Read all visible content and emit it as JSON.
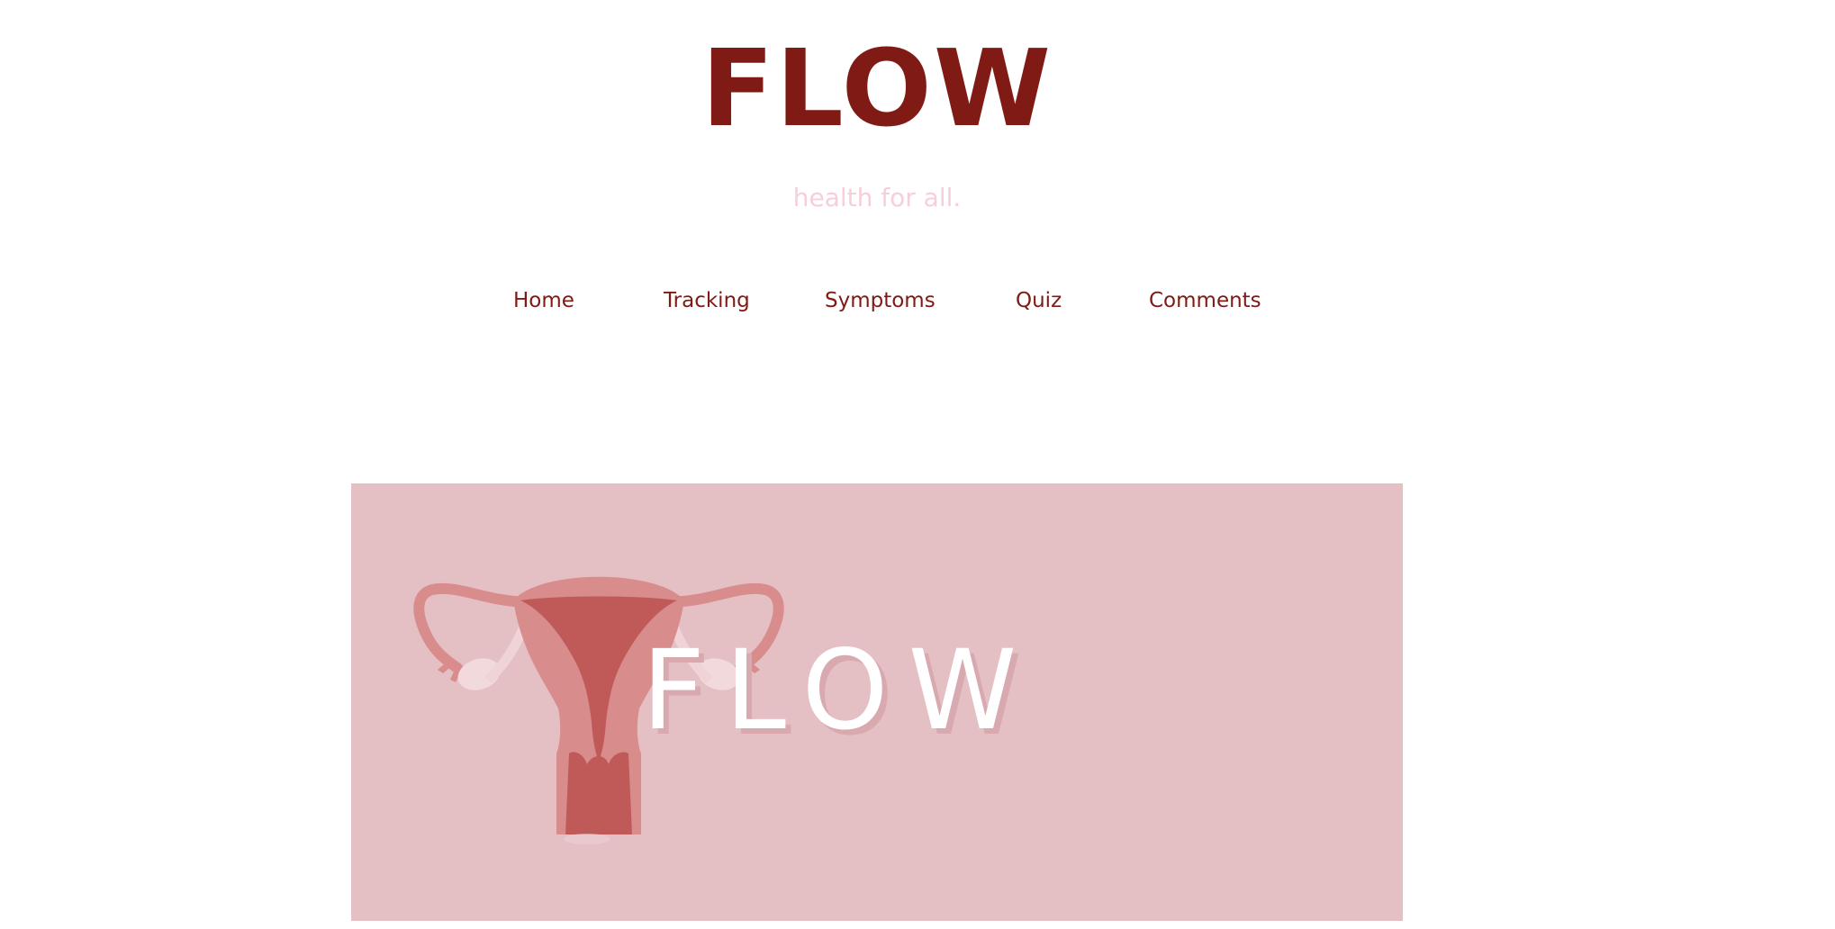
{
  "header": {
    "title": "FLOW",
    "tagline": "health for all."
  },
  "nav": {
    "items": [
      {
        "label": "Home"
      },
      {
        "label": "Tracking"
      },
      {
        "label": "Symptoms"
      },
      {
        "label": "Quiz"
      },
      {
        "label": "Comments"
      }
    ]
  },
  "hero": {
    "logo_text": "FLOW",
    "icon": "uterus-icon"
  },
  "colors": {
    "brand": "#7f1a14",
    "tagline": "#f6cfd8",
    "hero_background": "#e4bfc4",
    "icon_outer": "#d88c8c",
    "icon_inner": "#c05a59",
    "logo_text": "#ffffff"
  }
}
